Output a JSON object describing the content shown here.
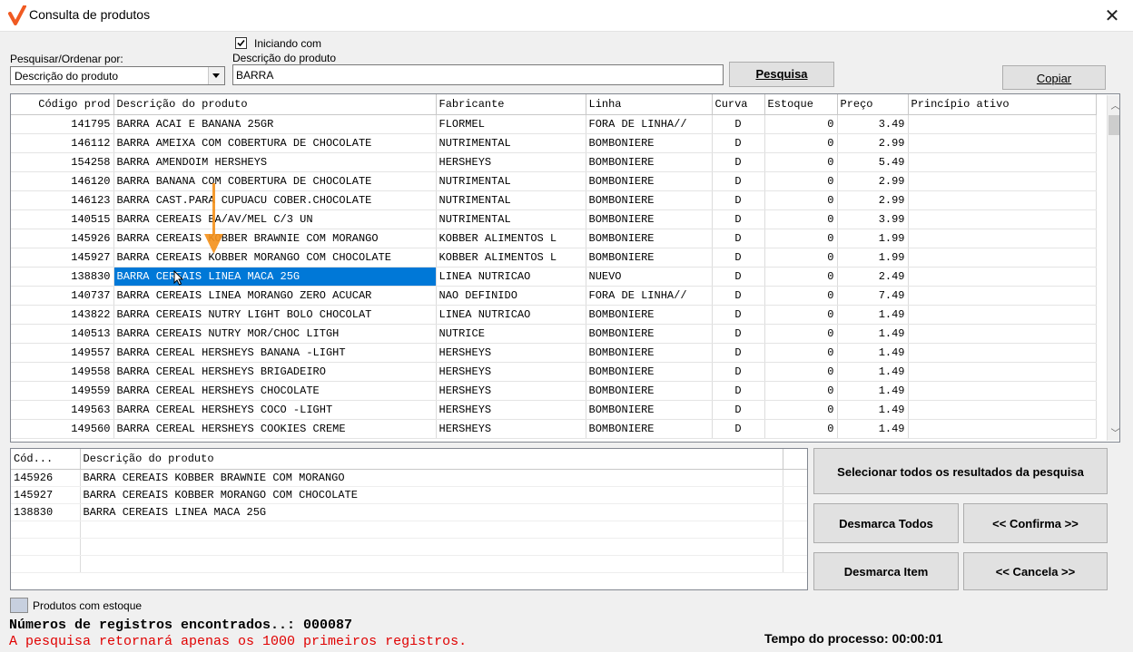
{
  "window": {
    "title": "Consulta de produtos"
  },
  "search": {
    "sort_label": "Pesquisar/Ordenar por:",
    "sort_value": "Descrição do produto",
    "checkbox_label": "Iniciando com",
    "checkbox_checked": true,
    "field_label": "Descrição do produto",
    "field_value": "BARRA",
    "search_button": "Pesquisa",
    "copy_button": "Copiar"
  },
  "grid": {
    "columns": [
      "Código prod",
      "Descrição do produto",
      "Fabricante",
      "Linha",
      "Curva",
      "Estoque",
      "Preço",
      "Princípio ativo"
    ],
    "rows": [
      [
        "141795",
        "BARRA ACAI E BANANA 25GR",
        "FLORMEL",
        "FORA DE LINHA//",
        "D",
        "0",
        "3.49",
        ""
      ],
      [
        "146112",
        "BARRA AMEIXA COM COBERTURA DE CHOCOLATE",
        "NUTRIMENTAL",
        "BOMBONIERE",
        "D",
        "0",
        "2.99",
        ""
      ],
      [
        "154258",
        "BARRA AMENDOIM HERSHEYS",
        "HERSHEYS",
        "BOMBONIERE",
        "D",
        "0",
        "5.49",
        ""
      ],
      [
        "146120",
        "BARRA BANANA COM COBERTURA DE CHOCOLATE",
        "NUTRIMENTAL",
        "BOMBONIERE",
        "D",
        "0",
        "2.99",
        ""
      ],
      [
        "146123",
        "BARRA CAST.PARA CUPUACU COBER.CHOCOLATE",
        "NUTRIMENTAL",
        "BOMBONIERE",
        "D",
        "0",
        "2.99",
        ""
      ],
      [
        "140515",
        "BARRA CEREAIS BA/AV/MEL C/3 UN",
        "NUTRIMENTAL",
        "BOMBONIERE",
        "D",
        "0",
        "3.99",
        ""
      ],
      [
        "145926",
        "BARRA CEREAIS KOBBER BRAWNIE COM MORANGO",
        "KOBBER ALIMENTOS L",
        "BOMBONIERE",
        "D",
        "0",
        "1.99",
        ""
      ],
      [
        "145927",
        "BARRA CEREAIS KOBBER MORANGO COM CHOCOLATE",
        "KOBBER ALIMENTOS L",
        "BOMBONIERE",
        "D",
        "0",
        "1.99",
        ""
      ],
      [
        "138830",
        "BARRA CEREAIS LINEA MACA 25G",
        "LINEA NUTRICAO",
        "NUEVO",
        "D",
        "0",
        "2.49",
        ""
      ],
      [
        "140737",
        "BARRA CEREAIS LINEA MORANGO ZERO ACUCAR",
        "NAO DEFINIDO",
        "FORA DE LINHA//",
        "D",
        "0",
        "7.49",
        ""
      ],
      [
        "143822",
        "BARRA CEREAIS NUTRY LIGHT BOLO CHOCOLAT",
        "LINEA NUTRICAO",
        "BOMBONIERE",
        "D",
        "0",
        "1.49",
        ""
      ],
      [
        "140513",
        "BARRA CEREAIS NUTRY MOR/CHOC LITGH",
        "NUTRICE",
        "BOMBONIERE",
        "D",
        "0",
        "1.49",
        ""
      ],
      [
        "149557",
        "BARRA CEREAL HERSHEYS BANANA -LIGHT",
        "HERSHEYS",
        "BOMBONIERE",
        "D",
        "0",
        "1.49",
        ""
      ],
      [
        "149558",
        "BARRA CEREAL HERSHEYS BRIGADEIRO",
        "HERSHEYS",
        "BOMBONIERE",
        "D",
        "0",
        "1.49",
        ""
      ],
      [
        "149559",
        "BARRA CEREAL HERSHEYS CHOCOLATE",
        "HERSHEYS",
        "BOMBONIERE",
        "D",
        "0",
        "1.49",
        ""
      ],
      [
        "149563",
        "BARRA CEREAL HERSHEYS COCO -LIGHT",
        "HERSHEYS",
        "BOMBONIERE",
        "D",
        "0",
        "1.49",
        ""
      ],
      [
        "149560",
        "BARRA CEREAL HERSHEYS COOKIES CREME",
        "HERSHEYS",
        "BOMBONIERE",
        "D",
        "0",
        "1.49",
        ""
      ]
    ],
    "selected_row_index": 8
  },
  "selection": {
    "columns": [
      "Cód...",
      "Descrição do produto"
    ],
    "rows": [
      [
        "145926",
        "BARRA CEREAIS KOBBER BRAWNIE COM MORANGO"
      ],
      [
        "145927",
        "BARRA CEREAIS KOBBER MORANGO COM CHOCOLATE"
      ],
      [
        "138830",
        "BARRA CEREAIS LINEA MACA 25G"
      ]
    ]
  },
  "actions": {
    "select_all": "Selecionar todos os resultados da pesquisa",
    "unmark_all": "Desmarca Todos",
    "confirm": "<< Confirma >>",
    "unmark_item": "Desmarca Item",
    "cancel": "<< Cancela >>"
  },
  "footer": {
    "legend_label": "Produtos com estoque",
    "records_found": "Números de registros encontrados..: 000087",
    "limit_warning": "A pesquisa retornará apenas os 1000 primeiros registros.",
    "process_time": "Tempo do processo: 00:00:01"
  },
  "colors": {
    "accent": "#0078d7",
    "arrow": "#f4921e",
    "logo": "#f05a22",
    "warning": "#e00000",
    "legend": "#c7d0df"
  },
  "icons": [
    "app-logo-icon",
    "close-icon",
    "chevron-down-icon",
    "check-icon",
    "mouse-cursor-icon",
    "scroll-up-icon",
    "scroll-down-icon",
    "orange-arrow-icon"
  ]
}
